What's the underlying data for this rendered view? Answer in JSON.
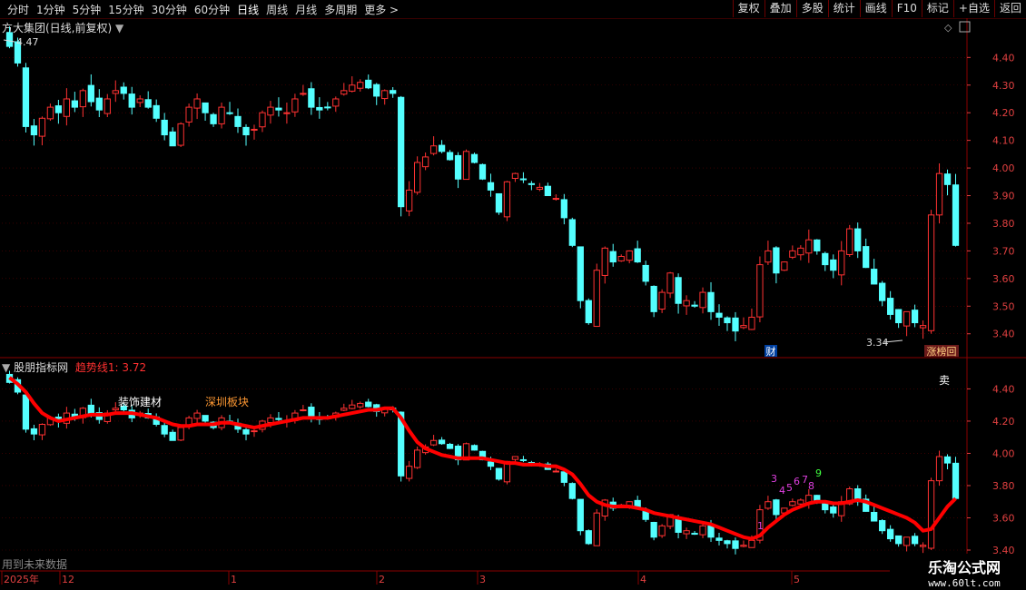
{
  "toolbar": {
    "periods": [
      "分时",
      "1分钟",
      "5分钟",
      "15分钟",
      "30分钟",
      "60分钟",
      "日线",
      "周线",
      "月线",
      "多周期",
      "更多 >"
    ],
    "actions": [
      "复权",
      "叠加",
      "多股",
      "统计",
      "画线",
      "F10",
      "标记",
      "+自选",
      "返回"
    ]
  },
  "main": {
    "title": "方大集团(日线,前复权)",
    "high_label": "4.47",
    "low_label": "3.34",
    "marker_cai": "财",
    "marker_zt": "涨榜回",
    "y_ticks": [
      "4.40",
      "4.30",
      "4.20",
      "4.10",
      "4.00",
      "3.90",
      "3.80",
      "3.70",
      "3.60",
      "3.50",
      "3.40"
    ]
  },
  "sub": {
    "title": "股朋指标网",
    "trend_label": "趋势线1: 3.72",
    "sector1": "装饰建材",
    "sector2": "深圳板块",
    "sell": "卖",
    "y_ticks": [
      "4.40",
      "4.20",
      "4.00",
      "3.80",
      "3.60",
      "3.40"
    ],
    "count_labels": [
      "1",
      "3",
      "4",
      "5",
      "6",
      "7",
      "8",
      "9"
    ]
  },
  "footer": {
    "note": "用到未来数据",
    "x_labels": [
      "2025年",
      "12",
      "1",
      "2",
      "3",
      "4",
      "5"
    ]
  },
  "watermark": {
    "line1": "乐淘公式网",
    "line2": "www.60lt.com"
  },
  "colors": {
    "up": "#ff3232",
    "down": "#54ffff",
    "trend": "#ff0000",
    "axis": "#e04040",
    "grid": "#5a0000"
  },
  "chart_data": {
    "type": "candlestick",
    "title": "方大集团(日线,前复权)",
    "x_period_labels": [
      "2025年",
      "12",
      "1",
      "2",
      "3",
      "4",
      "5"
    ],
    "ylim_main": [
      3.34,
      4.47
    ],
    "ylim_indicator": [
      3.4,
      4.47
    ],
    "close": [
      4.44,
      4.38,
      4.15,
      4.12,
      4.18,
      4.22,
      4.2,
      4.25,
      4.22,
      4.28,
      4.24,
      4.21,
      4.25,
      4.28,
      4.27,
      4.22,
      4.25,
      4.22,
      4.18,
      4.12,
      4.08,
      4.16,
      4.22,
      4.25,
      4.2,
      4.16,
      4.22,
      4.2,
      4.15,
      4.12,
      4.14,
      4.2,
      4.22,
      4.21,
      4.2,
      4.25,
      4.27,
      4.22,
      4.21,
      4.22,
      4.25,
      4.28,
      4.3,
      4.31,
      4.29,
      4.26,
      4.28,
      4.27,
      3.86,
      3.92,
      4.02,
      4.04,
      4.08,
      4.06,
      4.03,
      3.96,
      4.06,
      4.02,
      3.96,
      3.92,
      3.84,
      3.95,
      3.98,
      3.96,
      3.94,
      3.93,
      3.9,
      3.89,
      3.82,
      3.72,
      3.52,
      3.44,
      3.63,
      3.71,
      3.66,
      3.68,
      3.7,
      3.66,
      3.59,
      3.48,
      3.55,
      3.62,
      3.51,
      3.52,
      3.5,
      3.55,
      3.48,
      3.46,
      3.44,
      3.41,
      3.43,
      3.46,
      3.65,
      3.7,
      3.62,
      3.66,
      3.7,
      3.71,
      3.74,
      3.7,
      3.65,
      3.63,
      3.7,
      3.78,
      3.7,
      3.64,
      3.58,
      3.52,
      3.47,
      3.44,
      3.48,
      3.44,
      3.43,
      3.83,
      3.98,
      3.94,
      3.72
    ],
    "trend_line": [
      4.47,
      4.43,
      4.38,
      4.31,
      4.25,
      4.22,
      4.2,
      4.21,
      4.22,
      4.23,
      4.24,
      4.24,
      4.24,
      4.25,
      4.25,
      4.25,
      4.24,
      4.23,
      4.22,
      4.2,
      4.18,
      4.17,
      4.17,
      4.18,
      4.18,
      4.18,
      4.19,
      4.19,
      4.18,
      4.17,
      4.16,
      4.17,
      4.18,
      4.19,
      4.2,
      4.21,
      4.22,
      4.22,
      4.22,
      4.22,
      4.23,
      4.24,
      4.25,
      4.26,
      4.27,
      4.27,
      4.28,
      4.28,
      4.22,
      4.14,
      4.07,
      4.03,
      4.01,
      3.99,
      3.98,
      3.97,
      3.97,
      3.97,
      3.97,
      3.96,
      3.95,
      3.94,
      3.94,
      3.93,
      3.93,
      3.93,
      3.92,
      3.92,
      3.9,
      3.87,
      3.81,
      3.74,
      3.7,
      3.68,
      3.67,
      3.67,
      3.67,
      3.66,
      3.65,
      3.63,
      3.62,
      3.61,
      3.6,
      3.59,
      3.58,
      3.57,
      3.56,
      3.54,
      3.52,
      3.5,
      3.48,
      3.47,
      3.49,
      3.54,
      3.58,
      3.62,
      3.65,
      3.67,
      3.69,
      3.7,
      3.7,
      3.69,
      3.69,
      3.7,
      3.71,
      3.7,
      3.68,
      3.66,
      3.64,
      3.62,
      3.6,
      3.57,
      3.52,
      3.53,
      3.6,
      3.67,
      3.72
    ]
  }
}
